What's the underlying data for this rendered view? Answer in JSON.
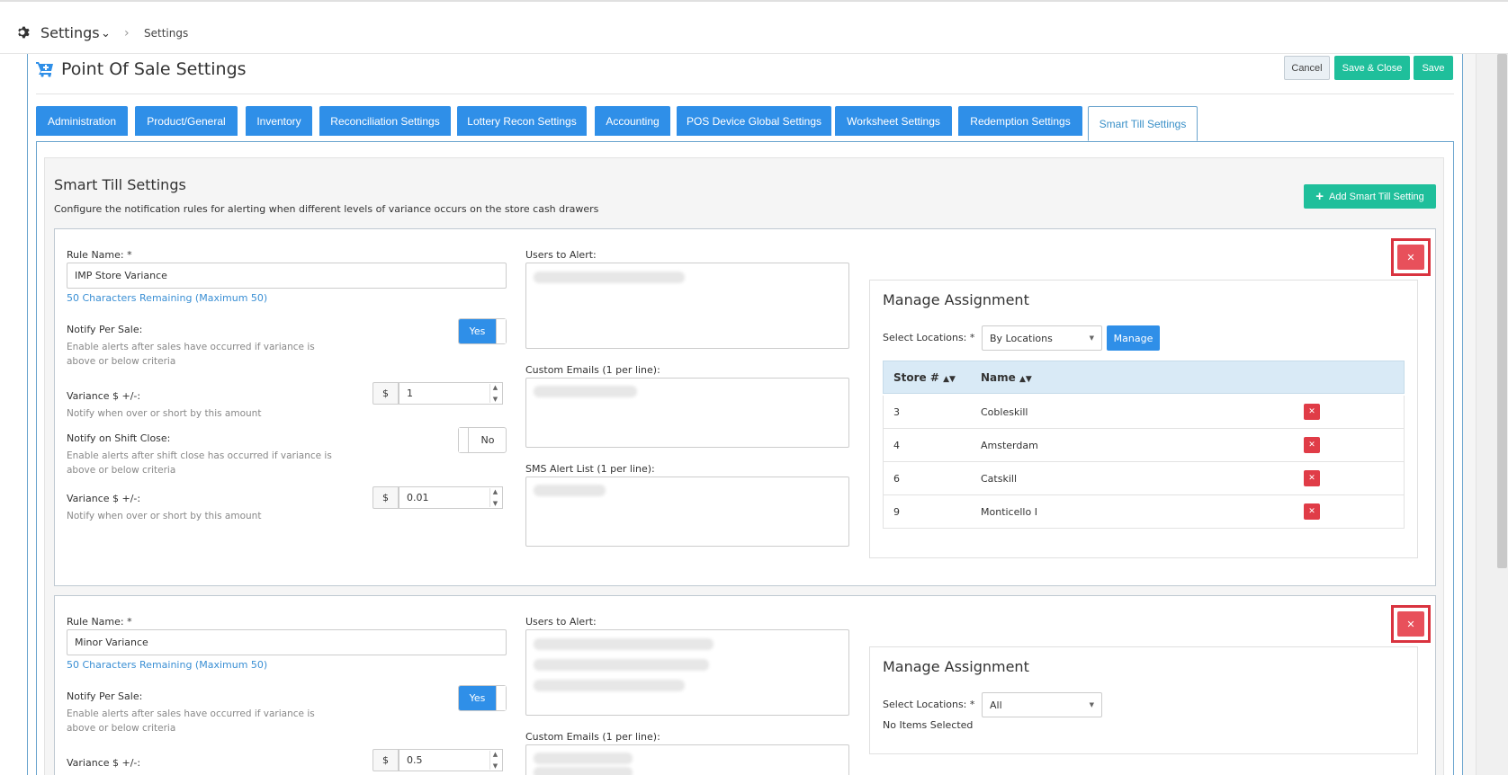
{
  "topbar": {
    "module": "Settings",
    "breadcrumb": "Settings"
  },
  "page": {
    "title": "Point Of Sale Settings"
  },
  "actions": {
    "cancel": "Cancel",
    "save_close": "Save & Close",
    "save": "Save"
  },
  "tabs": [
    {
      "label": "Administration"
    },
    {
      "label": "Product/General"
    },
    {
      "label": "Inventory"
    },
    {
      "label": "Reconciliation Settings"
    },
    {
      "label": "Lottery Recon Settings"
    },
    {
      "label": "Accounting"
    },
    {
      "label": "POS Device Global Settings"
    },
    {
      "label": "Worksheet Settings"
    },
    {
      "label": "Redemption Settings"
    },
    {
      "label": "Smart Till Settings",
      "active": true
    }
  ],
  "section": {
    "title": "Smart Till Settings",
    "description": "Configure the notification rules for alerting when different levels of variance occurs on the store cash drawers",
    "add_button": "Add Smart Till Setting"
  },
  "labels": {
    "rule_name": "Rule Name: *",
    "users_to_alert": "Users to Alert:",
    "custom_emails": "Custom Emails (1 per line):",
    "sms_alert_list": "SMS Alert List (1 per line):",
    "notify_per_sale": "Notify Per Sale:",
    "notify_per_sale_help": "Enable alerts after sales have occurred if variance is above or below criteria",
    "variance": "Variance $ +/-:",
    "variance_help": "Notify when over or short by this amount",
    "notify_shift_close": "Notify on Shift Close:",
    "notify_shift_close_help": "Enable alerts after shift close has occurred if variance is above or below criteria",
    "currency": "$",
    "manage_assignment": "Manage Assignment",
    "select_locations": "Select Locations: *",
    "manage_button": "Manage",
    "col_store": "Store #",
    "col_name": "Name",
    "no_items": "No Items Selected",
    "yes": "Yes",
    "no": "No"
  },
  "rules": [
    {
      "rule_name": "IMP Store Variance",
      "remaining": "50 Characters Remaining (Maximum 50)",
      "notify_per_sale": "Yes",
      "variance_sale": "1",
      "notify_shift_close": "No",
      "variance_shift": "0.01",
      "locations_select": "By Locations",
      "stores": [
        {
          "store": "3",
          "name": "Cobleskill"
        },
        {
          "store": "4",
          "name": "Amsterdam"
        },
        {
          "store": "6",
          "name": "Catskill"
        },
        {
          "store": "9",
          "name": "Monticello I"
        }
      ]
    },
    {
      "rule_name": "Minor Variance",
      "remaining": "50 Characters Remaining (Maximum 50)",
      "notify_per_sale": "Yes",
      "variance_sale": "0.5",
      "locations_select": "All"
    }
  ],
  "colors": {
    "primary": "#2f8fe8",
    "teal": "#1fbf9b",
    "danger": "#e8505b",
    "link": "#3a8fd4"
  },
  "icons": [
    "gear-icon",
    "chevron-down-icon",
    "chevron-right-icon",
    "cart-icon",
    "plus-icon",
    "close-icon",
    "sort-icon"
  ]
}
